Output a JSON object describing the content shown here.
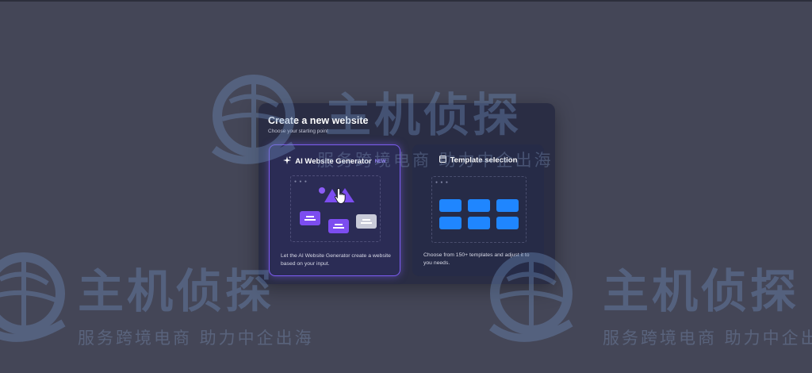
{
  "dialog": {
    "title": "Create a new website",
    "subtitle": "Choose your starting point"
  },
  "cards": {
    "ai": {
      "title": "AI Website Generator",
      "badge": "NEW",
      "description": "Let the AI Website Generator create a website based on your input.",
      "icon": "sparkle-icon"
    },
    "template": {
      "title": "Template selection",
      "description": "Choose from 150+ templates and adjust it to you needs.",
      "icon": "window-icon"
    }
  },
  "watermark": {
    "brand": "主机侦探",
    "slogan": "服务跨境电商  助力中企出海"
  },
  "colors": {
    "accent": "#7c5cf0",
    "template_tile": "#1f86ff",
    "dialog_bg": "#2a2d44",
    "page_bg": "#444657"
  }
}
